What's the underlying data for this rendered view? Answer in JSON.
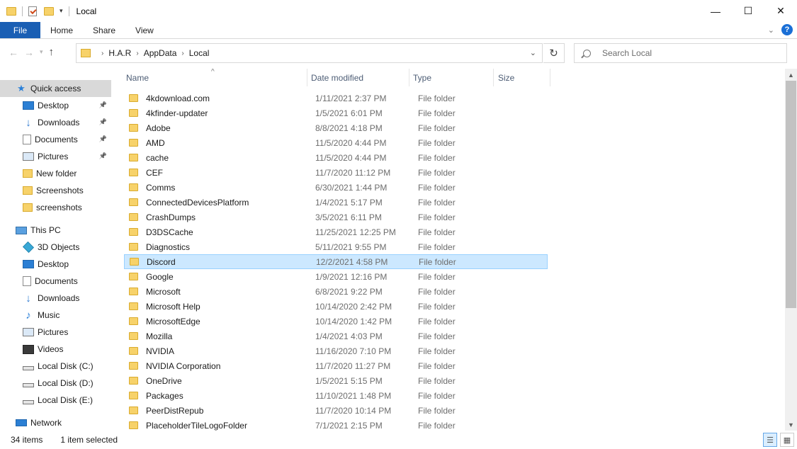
{
  "window": {
    "title": "Local",
    "minimize": "—",
    "maximize": "☐",
    "close": "✕"
  },
  "ribbon": {
    "tabs": [
      "File",
      "Home",
      "Share",
      "View"
    ],
    "help": "?"
  },
  "address": {
    "crumbs": [
      "H.A.R",
      "AppData",
      "Local"
    ],
    "search_placeholder": "Search Local"
  },
  "nav_pane": {
    "quick_access": "Quick access",
    "items": [
      {
        "label": "Quick access",
        "icon": "star-icon"
      },
      {
        "label": "Desktop",
        "icon": "desktop-icon",
        "pinned": true
      },
      {
        "label": "Downloads",
        "icon": "downloads-icon",
        "pinned": true
      },
      {
        "label": "Documents",
        "icon": "documents-icon",
        "pinned": true
      },
      {
        "label": "Pictures",
        "icon": "pictures-icon",
        "pinned": true
      },
      {
        "label": "New folder",
        "icon": "folder-icon"
      },
      {
        "label": "Screenshots",
        "icon": "folder-icon"
      },
      {
        "label": "screenshots",
        "icon": "folder-icon"
      },
      {
        "label": "This PC",
        "icon": "pc-icon"
      },
      {
        "label": "3D Objects",
        "icon": "3d-objects-icon"
      },
      {
        "label": "Desktop",
        "icon": "desktop-icon"
      },
      {
        "label": "Documents",
        "icon": "documents-icon"
      },
      {
        "label": "Downloads",
        "icon": "downloads-icon"
      },
      {
        "label": "Music",
        "icon": "music-icon"
      },
      {
        "label": "Pictures",
        "icon": "pictures-icon"
      },
      {
        "label": "Videos",
        "icon": "videos-icon"
      },
      {
        "label": "Local Disk (C:)",
        "icon": "disk-icon"
      },
      {
        "label": "Local Disk (D:)",
        "icon": "disk-icon"
      },
      {
        "label": "Local Disk (E:)",
        "icon": "disk-icon"
      },
      {
        "label": "Network",
        "icon": "network-icon"
      }
    ]
  },
  "columns": {
    "name": "Name",
    "date": "Date modified",
    "type": "Type",
    "size": "Size"
  },
  "files": [
    {
      "name": "4kdownload.com",
      "date": "1/11/2021 2:37 PM",
      "type": "File folder"
    },
    {
      "name": "4kfinder-updater",
      "date": "1/5/2021 6:01 PM",
      "type": "File folder"
    },
    {
      "name": "Adobe",
      "date": "8/8/2021 4:18 PM",
      "type": "File folder"
    },
    {
      "name": "AMD",
      "date": "11/5/2020 4:44 PM",
      "type": "File folder"
    },
    {
      "name": "cache",
      "date": "11/5/2020 4:44 PM",
      "type": "File folder"
    },
    {
      "name": "CEF",
      "date": "11/7/2020 11:12 PM",
      "type": "File folder"
    },
    {
      "name": "Comms",
      "date": "6/30/2021 1:44 PM",
      "type": "File folder"
    },
    {
      "name": "ConnectedDevicesPlatform",
      "date": "1/4/2021 5:17 PM",
      "type": "File folder"
    },
    {
      "name": "CrashDumps",
      "date": "3/5/2021 6:11 PM",
      "type": "File folder"
    },
    {
      "name": "D3DSCache",
      "date": "11/25/2021 12:25 PM",
      "type": "File folder"
    },
    {
      "name": "Diagnostics",
      "date": "5/11/2021 9:55 PM",
      "type": "File folder"
    },
    {
      "name": "Discord",
      "date": "12/2/2021 4:58 PM",
      "type": "File folder",
      "selected": true
    },
    {
      "name": "Google",
      "date": "1/9/2021 12:16 PM",
      "type": "File folder"
    },
    {
      "name": "Microsoft",
      "date": "6/8/2021 9:22 PM",
      "type": "File folder"
    },
    {
      "name": "Microsoft Help",
      "date": "10/14/2020 2:42 PM",
      "type": "File folder"
    },
    {
      "name": "MicrosoftEdge",
      "date": "10/14/2020 1:42 PM",
      "type": "File folder"
    },
    {
      "name": "Mozilla",
      "date": "1/4/2021 4:03 PM",
      "type": "File folder"
    },
    {
      "name": "NVIDIA",
      "date": "11/16/2020 7:10 PM",
      "type": "File folder"
    },
    {
      "name": "NVIDIA Corporation",
      "date": "11/7/2020 11:27 PM",
      "type": "File folder"
    },
    {
      "name": "OneDrive",
      "date": "1/5/2021 5:15 PM",
      "type": "File folder"
    },
    {
      "name": "Packages",
      "date": "11/10/2021 1:48 PM",
      "type": "File folder"
    },
    {
      "name": "PeerDistRepub",
      "date": "11/7/2020 10:14 PM",
      "type": "File folder"
    },
    {
      "name": "PlaceholderTileLogoFolder",
      "date": "7/1/2021 2:15 PM",
      "type": "File folder"
    }
  ],
  "status": {
    "count": "34 items",
    "selected": "1 item selected"
  },
  "colors": {
    "file_tab": "#1a5fb4",
    "selection_bg": "#cce8ff",
    "selection_border": "#99d1ff",
    "folder": "#f7d26a"
  }
}
